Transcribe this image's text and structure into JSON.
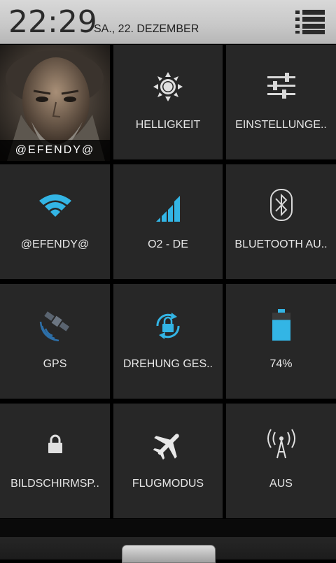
{
  "status": {
    "time": "22:29",
    "date": "SA., 22. DEZEMBER"
  },
  "tiles": {
    "profile": {
      "label": "@EFENDY@"
    },
    "brightness": {
      "label": "HELLIGKEIT"
    },
    "settings": {
      "label": "EINSTELLUNGE.."
    },
    "wifi": {
      "label": "@EFENDY@"
    },
    "mobile": {
      "label": "O2 - DE"
    },
    "bluetooth": {
      "label": "BLUETOOTH AU.."
    },
    "gps": {
      "label": "GPS"
    },
    "rotation": {
      "label": "DREHUNG GES.."
    },
    "battery": {
      "label": "74%",
      "level": 0.74
    },
    "lockscreen": {
      "label": "BILDSCHIRMSP.."
    },
    "airplane": {
      "label": "FLUGMODUS"
    },
    "hotspot": {
      "label": "AUS"
    }
  },
  "colors": {
    "accent": "#33b5e5",
    "tile": "#272727",
    "icon": "#e0e0e0"
  }
}
